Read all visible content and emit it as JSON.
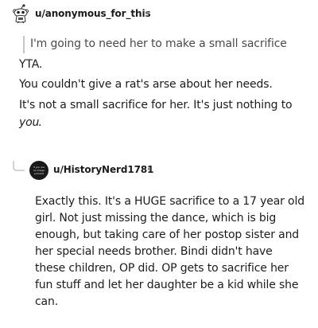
{
  "comment1": {
    "username": "u/anonymous_for_this",
    "separator": "•",
    "quote": "I'm going to need her to make a small sacrifice",
    "paragraphs": [
      "YTA.",
      "You couldn't give a rat's arse about her needs.",
      "It's not a small sacrifice for her. It's just nothing to"
    ],
    "emphasis_word": "you",
    "emphasis_tail": "."
  },
  "comment2": {
    "username": "u/HistoryNerd1781",
    "separator": "•",
    "avatar_text": [
      "if you are",
      "an image",
      "podcast"
    ],
    "body_lines": [
      "Exactly this. It's a HUGE sacrifice to a 17 year old",
      "girl. Not just missing the dance, which is big",
      "enough, but taking care of her postop sister and",
      "her special needs brother. Bindi didn't have",
      "these children, OP did. OP gets to sacrifice her",
      "fun stuff and let her daughter be a kid while she",
      "can."
    ]
  },
  "icons": {
    "avatar1": "snoo-avatar-icon",
    "reply": "reply-connector-icon"
  },
  "colors": {
    "text": "#1c1c1c",
    "quote_text": "#4a4a4a",
    "quote_bar": "#c6c6c6",
    "meta": "#878a8c"
  }
}
